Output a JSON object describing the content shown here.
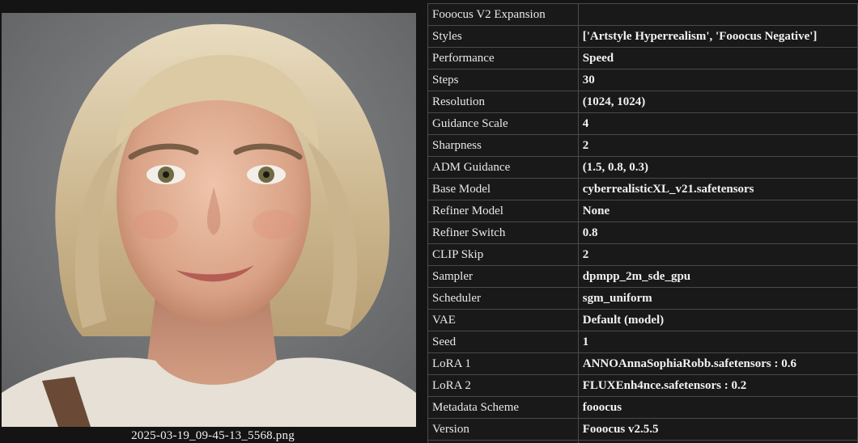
{
  "image": {
    "filename": "2025-03-19_09-45-13_5568.png",
    "alt": "portrait"
  },
  "metadata": {
    "rows": [
      {
        "key": "Fooocus V2 Expansion",
        "value": ""
      },
      {
        "key": "Styles",
        "value": "['Artstyle Hyperrealism', 'Fooocus Negative']"
      },
      {
        "key": "Performance",
        "value": "Speed"
      },
      {
        "key": "Steps",
        "value": "30"
      },
      {
        "key": "Resolution",
        "value": "(1024, 1024)"
      },
      {
        "key": "Guidance Scale",
        "value": "4"
      },
      {
        "key": "Sharpness",
        "value": "2"
      },
      {
        "key": "ADM Guidance",
        "value": "(1.5, 0.8, 0.3)"
      },
      {
        "key": "Base Model",
        "value": "cyberrealisticXL_v21.safetensors"
      },
      {
        "key": "Refiner Model",
        "value": "None"
      },
      {
        "key": "Refiner Switch",
        "value": "0.8"
      },
      {
        "key": "CLIP Skip",
        "value": "2"
      },
      {
        "key": "Sampler",
        "value": "dpmpp_2m_sde_gpu"
      },
      {
        "key": "Scheduler",
        "value": "sgm_uniform"
      },
      {
        "key": "VAE",
        "value": "Default (model)"
      },
      {
        "key": "Seed",
        "value": "1"
      },
      {
        "key": "LoRA 1",
        "value": "ANNOAnnaSophiaRobb.safetensors : 0.6"
      },
      {
        "key": "LoRA 2",
        "value": "FLUXEnh4nce.safetensors : 0.2"
      },
      {
        "key": "Metadata Scheme",
        "value": "fooocus"
      },
      {
        "key": "Version",
        "value": "Fooocus v2.5.5"
      }
    ]
  }
}
